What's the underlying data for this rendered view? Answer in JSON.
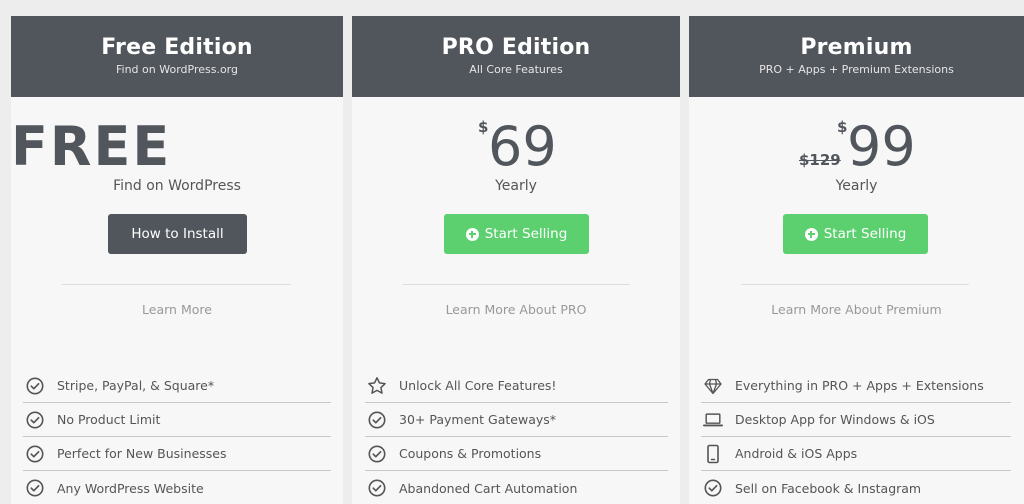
{
  "cards": [
    {
      "title": "Free Edition",
      "subtitle": "Find on WordPress.org",
      "price": "FREE",
      "period": "Find on WordPress",
      "button": "How to Install",
      "learn_more": "Learn More",
      "features": [
        {
          "icon": "check-circle-icon",
          "text": "Stripe, PayPal, & Square*"
        },
        {
          "icon": "check-circle-icon",
          "text": "No Product Limit"
        },
        {
          "icon": "check-circle-icon",
          "text": "Perfect for New Businesses"
        },
        {
          "icon": "check-circle-icon",
          "text": "Any WordPress Website"
        }
      ]
    },
    {
      "title": "PRO Edition",
      "subtitle": "All Core Features",
      "currency": "$",
      "price": "69",
      "period": "Yearly",
      "button": "Start Selling",
      "learn_more": "Learn More About PRO",
      "features": [
        {
          "icon": "star-icon",
          "text": "Unlock All Core Features!"
        },
        {
          "icon": "check-circle-icon",
          "text": "30+ Payment Gateways*"
        },
        {
          "icon": "check-circle-icon",
          "text": "Coupons & Promotions"
        },
        {
          "icon": "check-circle-icon",
          "text": "Abandoned Cart Automation"
        }
      ]
    },
    {
      "title": "Premium",
      "subtitle": "PRO + Apps + Premium Extensions",
      "currency": "$",
      "old_price": "$129",
      "price": "99",
      "period": "Yearly",
      "button": "Start Selling",
      "learn_more": "Learn More About Premium",
      "features": [
        {
          "icon": "diamond-icon",
          "text": "Everything in PRO + Apps + Extensions"
        },
        {
          "icon": "laptop-icon",
          "text": "Desktop App for Windows & iOS"
        },
        {
          "icon": "phone-icon",
          "text": "Android & iOS Apps"
        },
        {
          "icon": "check-circle-icon",
          "text": "Sell on Facebook & Instagram"
        }
      ]
    }
  ],
  "colors": {
    "header": "#51555c",
    "green_button": "#5cd06f",
    "dark_button": "#51555c"
  }
}
